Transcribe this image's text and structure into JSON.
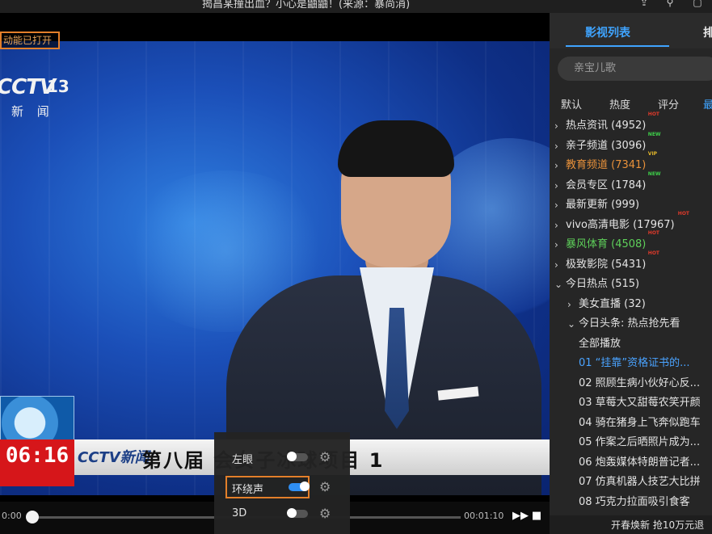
{
  "window": {
    "title": "揭昌某撞出血？小心是鼬鼬！(来源：暴尚消)",
    "icons": [
      "share-icon",
      "pin-icon",
      "minimize-icon"
    ]
  },
  "video": {
    "notice": "动能已打开",
    "channel_logo": "CCTV",
    "channel_number": "13",
    "channel_name": "新 闻",
    "ticker_clock": "06:16",
    "ticker_logo": "CCTV新闻",
    "ticker_text": "第八届      会女子冰球项目 1",
    "time_current": "0:00",
    "time_total": "00:01:10",
    "progress": 0
  },
  "audio_menu": {
    "items": [
      {
        "label": "左眼",
        "enabled": false,
        "highlighted": false
      },
      {
        "label": "环绕声",
        "enabled": true,
        "highlighted": true
      },
      {
        "label": "3D",
        "enabled": false,
        "highlighted": false
      }
    ]
  },
  "sidebar": {
    "tabs": [
      "影视列表",
      "排"
    ],
    "search_placeholder": "亲宝儿歌",
    "sorts": [
      "默认",
      "热度",
      "评分",
      "最"
    ],
    "categories": [
      {
        "label": "热点资讯 (4952)",
        "badge": "HOT",
        "color": "",
        "expanded": false
      },
      {
        "label": "亲子频道 (3096)",
        "badge": "NEW",
        "color": "",
        "expanded": false
      },
      {
        "label": "教育频道 (7341)",
        "badge": "VIP",
        "color": "orange",
        "expanded": false
      },
      {
        "label": "会员专区 (1784)",
        "badge": "NEW",
        "color": "",
        "expanded": false
      },
      {
        "label": "最新更新 (999)",
        "badge": "",
        "color": "",
        "expanded": false
      },
      {
        "label": "vivo高清电影 (17967)",
        "badge": "HOT",
        "color": "",
        "expanded": false
      },
      {
        "label": "暴风体育 (4508)",
        "badge": "HOT",
        "color": "green",
        "expanded": false
      },
      {
        "label": "极致影院 (5431)",
        "badge": "HOT",
        "color": "",
        "expanded": false
      },
      {
        "label": "今日热点 (515)",
        "badge": "",
        "color": "",
        "expanded": true
      }
    ],
    "sub_items": [
      {
        "label": "美女直播 (32)",
        "chev": "›"
      },
      {
        "label": "今日头条: 热点抢先看",
        "chev": "⌄"
      }
    ],
    "play_all": "全部播放",
    "episodes": [
      "01 “挂靠”资格证书的...",
      "02 照顾生病小伙好心反...",
      "03 草莓大又甜莓农笑开颜",
      "04 骑在猪身上飞奔似跑车",
      "05 作案之后晒照片成为...",
      "06 炮轰媒体特朗普记者...",
      "07 仿真机器人技艺大比拼",
      "08 巧克力拉面吸引食客"
    ],
    "footer": "开春焕新 抢10万元退"
  },
  "colors": {
    "accent": "#3fa4ff",
    "highlight_frame": "#e37f2a",
    "hot": "#e03a2b",
    "new": "#3ed04a",
    "vip": "#e2b52a"
  }
}
